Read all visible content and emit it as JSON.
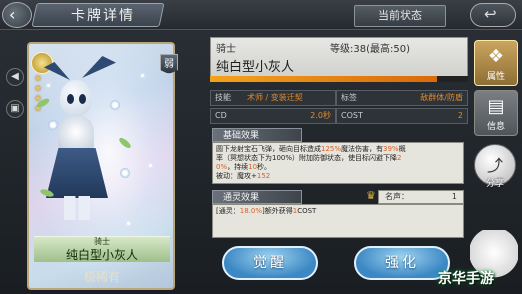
{
  "header": {
    "title": "卡牌详情",
    "state_button": "当前状态",
    "back_icon": "back-arrow",
    "exit_icon": "return-arrow"
  },
  "card": {
    "rank_badge": "弱",
    "class_label": "骑士",
    "name": "纯白型小灰人",
    "rarity": "极稀有",
    "stars": 4
  },
  "info": {
    "class": "骑士",
    "level_text": "等级:38(最高:50)",
    "name": "纯白型小灰人",
    "xp_fraction": 0.88,
    "skill_label": "技能",
    "skill_value": "术师 / 变装迁契",
    "tag_label": "标签",
    "tag_value": "敌群体/防盾",
    "cd_label": "CD",
    "cd_value": "2.0秒",
    "cost_label": "COST",
    "cost_value": "2"
  },
  "basic_effect": {
    "title": "基础效果",
    "line1_pre": "圆下龙射宝石飞弹，砸向目标造成",
    "line1_hl": "125%",
    "line1_post": "魔法伤害，有",
    "line1_hl2": "39%",
    "line1_end": "概",
    "line2_pre": "率（冥想状态下为100%）附加防御状态，使目标闪避下降",
    "line2_hl": "2",
    "line3_hl": "0%",
    "line3_mid": "，持续",
    "line3_hl2": "10",
    "line3_end": "秒。",
    "line4_pre": "被动：魔攻+",
    "line4_hl": "152"
  },
  "link_effect": {
    "title": "通灵效果",
    "fame_label": "名声：",
    "fame_value": "1",
    "text_pre": "[通灵：",
    "text_hl": "18.0%",
    "text_mid": "]额外获得",
    "text_hl2": "1",
    "text_end": "COST"
  },
  "buttons": {
    "awaken": "觉醒",
    "strengthen": "强化"
  },
  "right_tabs": [
    {
      "label": "属性",
      "icon": "attribute-icon"
    },
    {
      "label": "信息",
      "icon": "info-icon"
    }
  ],
  "share": {
    "label": "分享",
    "icon": "share-icon"
  },
  "watermark": "京华手游"
}
